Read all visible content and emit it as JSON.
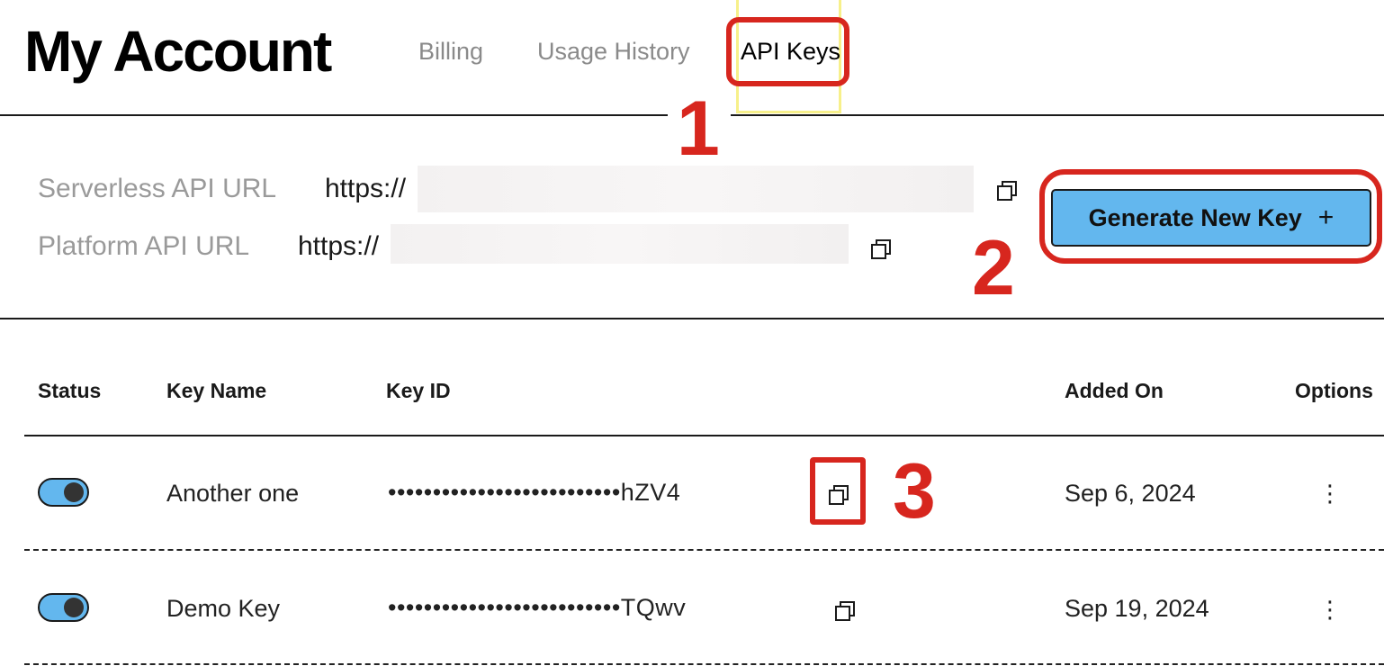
{
  "header": {
    "title": "My Account",
    "tabs": [
      {
        "label": "Billing"
      },
      {
        "label": "Usage History"
      },
      {
        "label": "API Keys"
      }
    ]
  },
  "api_urls": {
    "serverless": {
      "label": "Serverless API URL",
      "value": "https://"
    },
    "platform": {
      "label": "Platform API URL",
      "value": "https://"
    }
  },
  "generate_button": {
    "label": "Generate New Key",
    "icon": "+"
  },
  "annotations": [
    "1",
    "2",
    "3"
  ],
  "table": {
    "headers": [
      "Status",
      "Key Name",
      "Key ID",
      "Added On",
      "Options"
    ],
    "rows": [
      {
        "enabled": true,
        "name": "Another one",
        "key_id": "••••••••••••••••••••••••••hZV4",
        "added_on": "Sep 6, 2024",
        "options": "⋮"
      },
      {
        "enabled": true,
        "name": "Demo Key",
        "key_id": "••••••••••••••••••••••••••TQwv",
        "added_on": "Sep 19, 2024",
        "options": "⋮"
      }
    ]
  },
  "colors": {
    "accent": "#63b7ee",
    "annotation": "#d7261e",
    "tab_highlight": "#f7f08a"
  }
}
